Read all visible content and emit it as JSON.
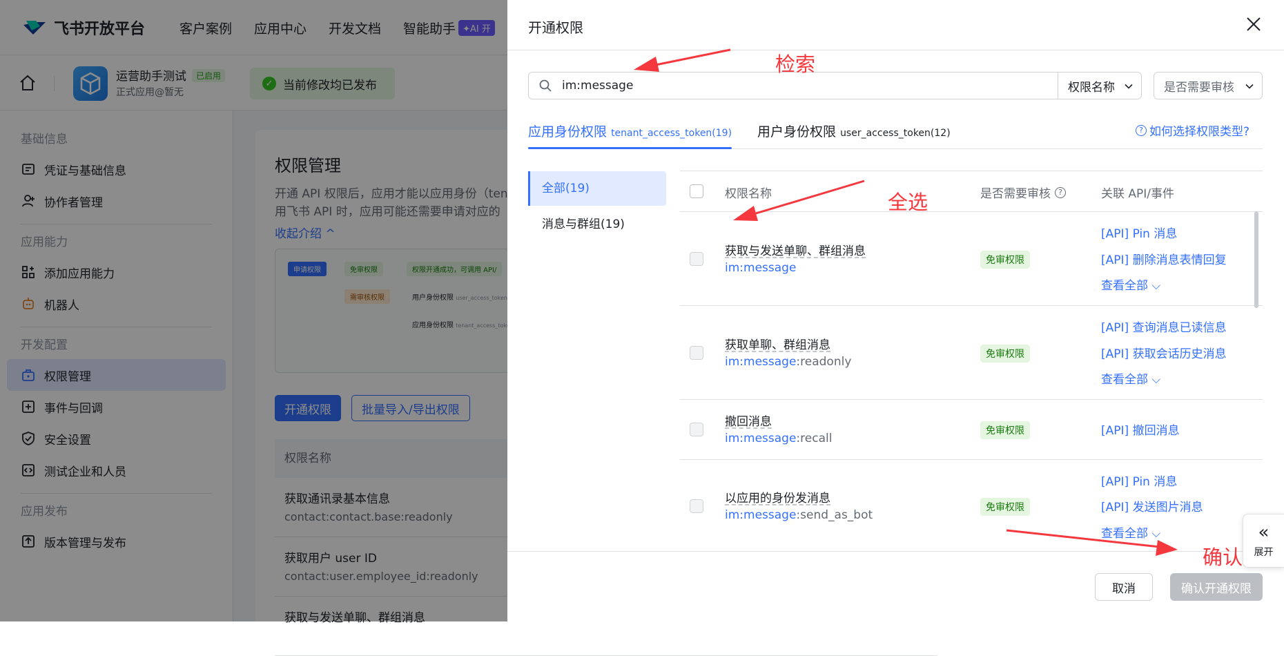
{
  "topbar": {
    "brand": "飞书开放平台",
    "nav": [
      "客户案例",
      "应用中心",
      "开发文档",
      "智能助手"
    ],
    "ai_badge": "✦AI 开"
  },
  "appbar": {
    "app_name": "运营助手测试",
    "app_state": "已启用",
    "app_sub": "正式应用@暂无",
    "publish_status": "当前修改均已发布"
  },
  "sidebar": {
    "groups": [
      {
        "label": "基础信息",
        "items": [
          {
            "label": "凭证与基础信息",
            "icon": "credential-icon"
          },
          {
            "label": "协作者管理",
            "icon": "user-icon"
          }
        ]
      },
      {
        "label": "应用能力",
        "items": [
          {
            "label": "添加应用能力",
            "icon": "grid-plus-icon"
          },
          {
            "label": "机器人",
            "icon": "robot-icon"
          }
        ]
      },
      {
        "label": "开发配置",
        "items": [
          {
            "label": "权限管理",
            "icon": "lock-box-icon",
            "active": true
          },
          {
            "label": "事件与回调",
            "icon": "plus-square-icon"
          },
          {
            "label": "安全设置",
            "icon": "shield-icon"
          },
          {
            "label": "测试企业和人员",
            "icon": "code-icon"
          }
        ]
      },
      {
        "label": "应用发布",
        "items": [
          {
            "label": "版本管理与发布",
            "icon": "upload-icon"
          }
        ]
      }
    ]
  },
  "main": {
    "title": "权限管理",
    "desc_line1": "开通 API 权限后，应用才能以应用身份（ten",
    "desc_line2": "用飞书 API 时，应用可能还需要申请对应的",
    "collapse": "收起介绍 ^",
    "diagram": {
      "apply": "申请权限",
      "no_review": "免审权限",
      "success": "权限开通成功，可调用 API/",
      "need_review": "需审核权限",
      "user_perm": "用户身份权限",
      "user_token": "user_access_token",
      "app_perm": "应用身份权限",
      "tenant_token": "tenant_access_toke"
    },
    "btn_open": "开通权限",
    "btn_batch": "批量导入/导出权限",
    "table_head": "权限名称",
    "rows": [
      {
        "name": "获取通讯录基本信息",
        "code": "contact:contact.base:readonly"
      },
      {
        "name": "获取用户 user ID",
        "code": "contact:user.employee_id:readonly"
      },
      {
        "name": "获取与发送单聊、群组消息",
        "code": ""
      }
    ]
  },
  "drawer": {
    "title": "开通权限",
    "search_value": "im:message",
    "filter_name": "权限名称",
    "filter_review": "是否需要审核",
    "tab_app": "应用身份权限",
    "tab_app_token": "tenant_access_token(19)",
    "tab_user": "用户身份权限",
    "tab_user_token": "user_access_token(12)",
    "help": "如何选择权限类型?",
    "categories": [
      "全部(19)",
      "消息与群组(19)"
    ],
    "columns": {
      "name": "权限名称",
      "review": "是否需要审核",
      "api": "关联 API/事件"
    },
    "rows": [
      {
        "name": "获取与发送单聊、群组消息",
        "prefix": "im:message",
        "suffix": "",
        "badge": "免审权限",
        "apis": [
          "[API] Pin 消息",
          "[API] 删除消息表情回复"
        ],
        "more": "查看全部 ⌵"
      },
      {
        "name": "获取单聊、群组消息",
        "prefix": "im:message",
        "suffix": ":readonly",
        "badge": "免审权限",
        "apis": [
          "[API] 查询消息已读信息",
          "[API] 获取会话历史消息"
        ],
        "more": "查看全部 ⌵"
      },
      {
        "name": "撤回消息",
        "prefix": "im:message",
        "suffix": ":recall",
        "badge": "免审权限",
        "apis": [
          "[API] 撤回消息"
        ],
        "more": ""
      },
      {
        "name": "以应用的身份发消息",
        "prefix": "im:message",
        "suffix": ":send_as_bot",
        "badge": "免审权限",
        "apis": [
          "[API] Pin 消息",
          "[API] 发送图片消息"
        ],
        "more": "查看全部 ⌵"
      }
    ],
    "cancel": "取消",
    "confirm": "确认开通权限",
    "expand_label": "展开"
  },
  "annotations": {
    "search": "检索",
    "select_all": "全选",
    "confirm": "确认",
    "color": "#f5383e"
  },
  "colors": {
    "accent": "#3370ff",
    "success_bg": "#e4f6e0",
    "success_text": "#1d7a12"
  }
}
